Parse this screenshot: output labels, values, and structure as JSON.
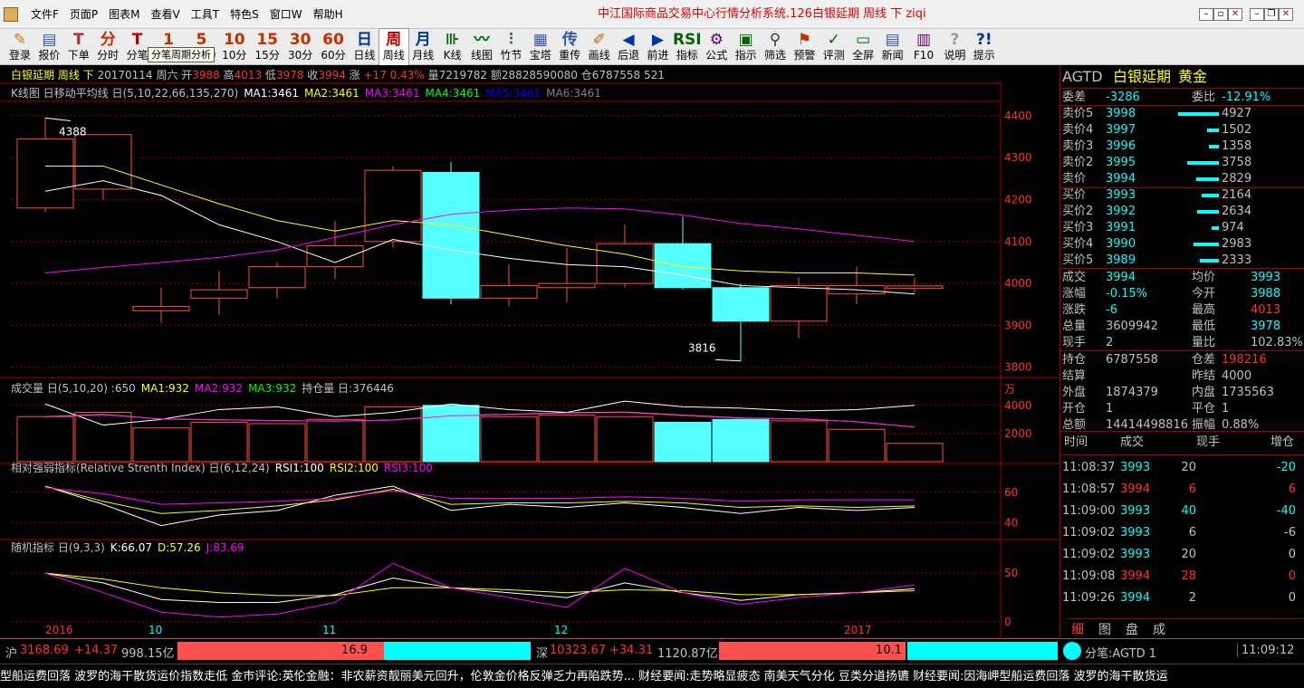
{
  "app": {
    "title": "中江国际商品交易中心行情分析系统.126白银延期 周线 下 ziqi",
    "menus": [
      "文件F",
      "页面P",
      "图表M",
      "查看V",
      "工具T",
      "特色S",
      "窗口W",
      "帮助H"
    ]
  },
  "toolbar": {
    "items": [
      {
        "icon": "✎",
        "label": "登录",
        "color": "#c08000"
      },
      {
        "icon": "▤",
        "label": "报价",
        "color": "#3355aa"
      },
      {
        "icon": "T",
        "label": "下单",
        "color": "#b03030"
      },
      {
        "icon": "分",
        "label": "分时",
        "color": "#c03000"
      },
      {
        "icon": "T",
        "label": "分笔",
        "color": "#c00000"
      },
      {
        "icon": "1",
        "label": "1分钟",
        "color": "#c03000"
      },
      {
        "icon": "5",
        "label": "5分钟",
        "color": "#c03000"
      },
      {
        "icon": "10",
        "label": "10分",
        "color": "#c03000"
      },
      {
        "icon": "15",
        "label": "15分",
        "color": "#c03000"
      },
      {
        "icon": "30",
        "label": "30分",
        "color": "#c03000"
      },
      {
        "icon": "60",
        "label": "60分",
        "color": "#c03000"
      },
      {
        "icon": "日",
        "label": "日线",
        "color": "#0033aa"
      },
      {
        "icon": "周",
        "label": "周线",
        "color": "#c00000",
        "selected": true
      },
      {
        "icon": "月",
        "label": "月线",
        "color": "#0033aa"
      },
      {
        "icon": "⊪",
        "label": "K线",
        "color": "#006600"
      },
      {
        "icon": "〰",
        "label": "线图",
        "color": "#006600"
      },
      {
        "icon": "⫶",
        "label": "竹节",
        "color": "#006600"
      },
      {
        "icon": "▦",
        "label": "宝塔",
        "color": "#3355aa"
      },
      {
        "icon": "传",
        "label": "重传",
        "color": "#3355aa"
      },
      {
        "icon": "✐",
        "label": "画线",
        "color": "#aa6600"
      },
      {
        "icon": "◀",
        "label": "后退",
        "color": "#0033aa"
      },
      {
        "icon": "▶",
        "label": "前进",
        "color": "#0033aa"
      },
      {
        "icon": "RSI",
        "label": "指标",
        "color": "#006600"
      },
      {
        "icon": "⚙",
        "label": "公式",
        "color": "#660066"
      },
      {
        "icon": "▣",
        "label": "指示",
        "color": "#006600"
      },
      {
        "icon": "⚲",
        "label": "筛选",
        "color": "#333333"
      },
      {
        "icon": "⚑",
        "label": "预警",
        "color": "#c03000"
      },
      {
        "icon": "✓",
        "label": "评测",
        "color": "#006600"
      },
      {
        "icon": "▭",
        "label": "全屏",
        "color": "#006600"
      },
      {
        "icon": "▤",
        "label": "新闻",
        "color": "#3355aa"
      },
      {
        "icon": "▥",
        "label": "F10",
        "color": "#660066"
      },
      {
        "icon": "?",
        "label": "说明",
        "color": "#999999"
      },
      {
        "icon": "?!",
        "label": "提示",
        "color": "#0033aa"
      }
    ],
    "tooltip": "分笔周期分析"
  },
  "header": {
    "name": "白银延期 周线 下",
    "date": "20170114 周六",
    "open_label": "开",
    "open": "3988",
    "high_label": "高",
    "high": "4013",
    "low_label": "低",
    "low": "3978",
    "close_label": "收",
    "close": "3994",
    "chg_label": "涨",
    "chg": "+17",
    "pct": "0.43%",
    "vol_label": "量",
    "vol": "7219782",
    "amt_label": "额",
    "amt": "28828590080",
    "oi_label": "仓",
    "oi": "6787558 521"
  },
  "legends": {
    "k": [
      {
        "text": "K线图 日移动平均线 日(5,10,22,66,135,270)",
        "color": "#c0c0c0"
      },
      {
        "text": "MA1:3461",
        "color": "#ffffff"
      },
      {
        "text": "MA2:3461",
        "color": "#ffff00"
      },
      {
        "text": "MA3:3461",
        "color": "#ff00ff"
      },
      {
        "text": "MA4:3461",
        "color": "#00ff00"
      },
      {
        "text": "MA5:3461",
        "color": "#0000ff"
      },
      {
        "text": "MA6:3461",
        "color": "#808080"
      }
    ],
    "vol": [
      {
        "text": "成交量 日(5,10,20) :650",
        "color": "#c0c0c0"
      },
      {
        "text": "MA1:932",
        "color": "#ffff00"
      },
      {
        "text": "MA2:932",
        "color": "#ff00ff"
      },
      {
        "text": "MA3:932",
        "color": "#00ff00"
      },
      {
        "text": "持仓量 日:376446",
        "color": "#c0c0c0"
      }
    ],
    "rsi": [
      {
        "text": "相对强弱指标(Relative Strenth Index) 日(6,12,24)",
        "color": "#c0c0c0"
      },
      {
        "text": "RSI1:100",
        "color": "#ffffff"
      },
      {
        "text": "RSI2:100",
        "color": "#ffff00"
      },
      {
        "text": "RSI3:100",
        "color": "#ff00ff"
      }
    ],
    "kdj": [
      {
        "text": "随机指标 日(9,3,3)",
        "color": "#c0c0c0"
      },
      {
        "text": "K:66.07",
        "color": "#ffffff"
      },
      {
        "text": "D:57.26",
        "color": "#ffff00"
      },
      {
        "text": "J:83.69",
        "color": "#ff00ff"
      }
    ]
  },
  "chart_data": {
    "type": "candlestick",
    "ylim": [
      3780,
      4430
    ],
    "yticks": [
      "4400",
      "4300",
      "4200",
      "4100",
      "4000",
      "3900",
      "3800"
    ],
    "vol_unit": "万",
    "vol_ticks": [
      "4000",
      "2000"
    ],
    "rsi_ticks": [
      "60",
      "40"
    ],
    "kdj_ticks": [
      "50",
      "0"
    ],
    "high_label": "4388",
    "low_label": "3816",
    "xlabels": [
      "2016",
      "10",
      "11",
      "12",
      "2017"
    ],
    "candles": [
      {
        "o": 4180,
        "h": 4395,
        "l": 4170,
        "c": 4345
      },
      {
        "o": 4225,
        "h": 4355,
        "l": 4200,
        "c": 4355
      },
      {
        "o": 3935,
        "h": 3990,
        "l": 3905,
        "c": 3945
      },
      {
        "o": 3965,
        "h": 4030,
        "l": 3925,
        "c": 3985
      },
      {
        "o": 3990,
        "h": 4050,
        "l": 3965,
        "c": 4040
      },
      {
        "o": 4040,
        "h": 4150,
        "l": 4010,
        "c": 4090
      },
      {
        "o": 4100,
        "h": 4280,
        "l": 4085,
        "c": 4270
      },
      {
        "o": 4265,
        "h": 4290,
        "l": 3950,
        "c": 3965
      },
      {
        "o": 3965,
        "h": 4045,
        "l": 3945,
        "c": 3995
      },
      {
        "o": 3990,
        "h": 4085,
        "l": 3955,
        "c": 4000
      },
      {
        "o": 4000,
        "h": 4140,
        "l": 3990,
        "c": 4095
      },
      {
        "o": 4095,
        "h": 4160,
        "l": 3985,
        "c": 3990
      },
      {
        "o": 3990,
        "h": 4000,
        "l": 3815,
        "c": 3910
      },
      {
        "o": 3910,
        "h": 4015,
        "l": 3870,
        "c": 3995
      },
      {
        "o": 3975,
        "h": 4040,
        "l": 3950,
        "c": 3995
      },
      {
        "o": 3988,
        "h": 4013,
        "l": 3978,
        "c": 3994
      }
    ],
    "ma": [
      {
        "name": "MA1",
        "color": "#ffffff",
        "values": [
          4220,
          4245,
          4210,
          4140,
          4100,
          4050,
          4105,
          4080,
          4060,
          4045,
          4040,
          4020,
          3995,
          3990,
          3985,
          3975
        ]
      },
      {
        "name": "MA2",
        "color": "#ffff00",
        "values": [
          4280,
          4280,
          4235,
          4190,
          4150,
          4125,
          4150,
          4140,
          4115,
          4090,
          4070,
          4040,
          4030,
          4025,
          4025,
          4020
        ]
      },
      {
        "name": "MA3",
        "color": "#ff00ff",
        "values": [
          4025,
          4038,
          4050,
          4062,
          4080,
          4110,
          4140,
          4165,
          4175,
          4180,
          4178,
          4163,
          4143,
          4130,
          4115,
          4100
        ]
      }
    ],
    "volume": [
      3200,
      3500,
      2400,
      2800,
      2700,
      3000,
      3900,
      4000,
      3200,
      3300,
      3200,
      2800,
      3000,
      2900,
      2300,
      1300
    ],
    "oi": [
      4100,
      2600,
      3000,
      3700,
      3900,
      3200,
      3500,
      4100,
      3700,
      3500,
      4300,
      3900,
      3800,
      3600,
      3700,
      4000
    ],
    "rsi": {
      "r1": [
        64,
        52,
        38,
        45,
        48,
        58,
        64,
        48,
        52,
        50,
        53,
        50,
        46,
        50,
        48,
        50
      ],
      "r2": [
        64,
        54,
        46,
        48,
        51,
        55,
        62,
        52,
        53,
        53,
        54,
        53,
        50,
        51,
        50,
        51
      ],
      "r3": [
        63,
        59,
        52,
        53,
        54,
        56,
        61,
        56,
        56,
        56,
        57,
        56,
        54,
        55,
        55,
        55
      ]
    },
    "kdj": {
      "k": [
        50,
        40,
        23,
        20,
        20,
        28,
        45,
        35,
        30,
        25,
        40,
        30,
        22,
        28,
        30,
        34
      ],
      "d": [
        50,
        44,
        35,
        30,
        27,
        27,
        35,
        35,
        33,
        30,
        33,
        32,
        28,
        28,
        30,
        32
      ],
      "j": [
        50,
        30,
        10,
        5,
        8,
        20,
        60,
        35,
        25,
        15,
        55,
        30,
        18,
        25,
        30,
        38
      ]
    }
  },
  "side": {
    "code": "AGTD",
    "name": "白银延期",
    "kind": "黄金",
    "wc": [
      {
        "l": "委差",
        "v": "-3286",
        "vc": "#00ffff"
      },
      {
        "l": "委比",
        "v": "-12.91%",
        "vc": "#00ffff"
      }
    ],
    "asks": [
      {
        "l": "卖价5",
        "p": "3998",
        "q": "4927",
        "bar": 0.9
      },
      {
        "l": "卖价4",
        "p": "3997",
        "q": "1502",
        "bar": 0.25
      },
      {
        "l": "卖价3",
        "p": "3996",
        "q": "1358",
        "bar": 0.22
      },
      {
        "l": "卖价2",
        "p": "3995",
        "q": "3758",
        "bar": 0.7
      },
      {
        "l": "卖价",
        "p": "3994",
        "q": "2829",
        "bar": 0.5
      }
    ],
    "bids": [
      {
        "l": "买价",
        "p": "3993",
        "q": "2164",
        "bar": 0.38
      },
      {
        "l": "买价2",
        "p": "3992",
        "q": "2634",
        "bar": 0.48
      },
      {
        "l": "买价3",
        "p": "3991",
        "q": "974",
        "bar": 0.15
      },
      {
        "l": "买价4",
        "p": "3990",
        "q": "2983",
        "bar": 0.55
      },
      {
        "l": "买价5",
        "p": "3989",
        "q": "2333",
        "bar": 0.42
      }
    ],
    "stats": [
      {
        "l": "成交",
        "v": "3994",
        "vc": "#00ffff",
        "l2": "均价",
        "v2": "3993",
        "v2c": "#00ffff"
      },
      {
        "l": "涨幅",
        "v": "-0.15%",
        "vc": "#00ffff",
        "l2": "今开",
        "v2": "3988",
        "v2c": "#00ffff"
      },
      {
        "l": "涨跌",
        "v": "-6",
        "vc": "#00ffff",
        "l2": "最高",
        "v2": "4013",
        "v2c": "#ff3030"
      },
      {
        "l": "总量",
        "v": "3609942",
        "vc": "#c0c0c0",
        "l2": "最低",
        "v2": "3978",
        "v2c": "#00ffff"
      },
      {
        "l": "现手",
        "v": "2",
        "vc": "#c0c0c0",
        "l2": "量比",
        "v2": "102.83%",
        "v2c": "#c0c0c0"
      }
    ],
    "stats2": [
      {
        "l": "持仓",
        "v": "6787558",
        "vc": "#c0c0c0",
        "l2": "仓差",
        "v2": "198216",
        "v2c": "#ff3030"
      },
      {
        "l": "结算",
        "v": "",
        "vc": "#c0c0c0",
        "l2": "昨结",
        "v2": "4000",
        "v2c": "#c0c0c0"
      },
      {
        "l": "外盘",
        "v": "1874379",
        "vc": "#c0c0c0",
        "l2": "内盘",
        "v2": "1735563",
        "v2c": "#c0c0c0"
      },
      {
        "l": "开仓",
        "v": "1",
        "vc": "#c0c0c0",
        "l2": "平仓",
        "v2": "1",
        "v2c": "#c0c0c0"
      },
      {
        "l": "总额",
        "v": "14414498816",
        "vc": "#c0c0c0",
        "l2": "振幅",
        "v2": "0.88%",
        "v2c": "#c0c0c0"
      }
    ],
    "tick_headers": [
      "时间",
      "成交",
      "现手",
      "增仓"
    ],
    "ticks": [
      {
        "t": "11:08:37",
        "p": "3993",
        "q": "20",
        "qc": "#c0c0c0",
        "d": "-20",
        "dc": "#00ffff"
      },
      {
        "t": "11:08:57",
        "p": "3994",
        "q": "6",
        "qc": "#ff3030",
        "d": "6",
        "dc": "#ff3030"
      },
      {
        "t": "11:09:00",
        "p": "3993",
        "q": "40",
        "qc": "#00ffff",
        "d": "-40",
        "dc": "#00ffff"
      },
      {
        "t": "11:09:02",
        "p": "3993",
        "q": "6",
        "qc": "#c0c0c0",
        "d": "-6",
        "dc": "#c0c0c0"
      },
      {
        "t": "11:09:02",
        "p": "3993",
        "q": "20",
        "qc": "#c0c0c0",
        "d": "0",
        "dc": "#c0c0c0"
      },
      {
        "t": "11:09:08",
        "p": "3994",
        "q": "28",
        "qc": "#ff3030",
        "d": "0",
        "dc": "#ff3030"
      },
      {
        "t": "11:09:26",
        "p": "3994",
        "q": "2",
        "qc": "#c0c0c0",
        "d": "0",
        "dc": "#c0c0c0"
      }
    ],
    "tabs": [
      "细",
      "图",
      "盘",
      "成"
    ]
  },
  "status": {
    "sh_label": "沪",
    "sh": "3168.69",
    "sh_chg": "+14.37",
    "sh_amt": "998.15亿",
    "sh_bar": "16.9",
    "sz_label": "深",
    "sz": "10323.67",
    "sz_chg": "+34.31",
    "sz_amt": "1120.87亿",
    "sz_bar": "10.1",
    "code_label": "分笔:AGTD 1",
    "time": "11:09:12"
  },
  "ticker": "型船运费回落 波罗的海干散货运价指数走低    金市评论:英伦金融：非农薪资靓丽美元回升，伦敦金价格反弹乏力再陷跌势...    财经要闻:走势略显疲态 南美天气分化 豆类分道扬镳    财经要闻:因海岬型船运费回落 波罗的海干散货运"
}
